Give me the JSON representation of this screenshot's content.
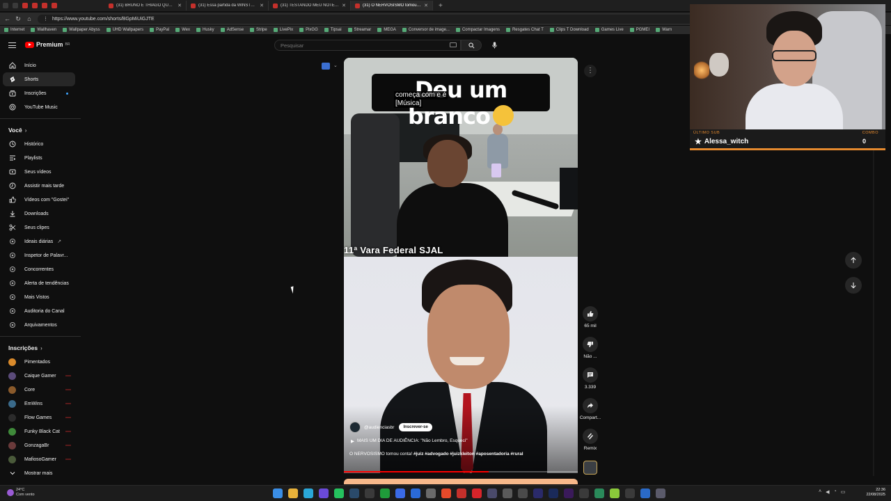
{
  "browser": {
    "tabs": [
      {
        "title": "(31) BRUNO E THIAGO QUATRO CA",
        "active": false
      },
      {
        "title": "(31) Essa partida da WINSTREAK",
        "active": false
      },
      {
        "title": "(31) TESTANDO MEU NOTEBOOK",
        "active": false
      },
      {
        "title": "(31) O NERVOSISMO tomou conta",
        "active": true
      }
    ],
    "new_tab": "+",
    "url": "https://www.youtube.com/shorts/BGpMiUiGJTE",
    "bookmarks": [
      "Internet",
      "Wallhaven",
      "Wallpaper Abyss",
      "UHD Wallpapers",
      "PayPal",
      "Wex",
      "Husky",
      "AdSense",
      "Stripe",
      "LivePix",
      "PixGG",
      "Tipsai",
      "Streamar",
      "MEGA",
      "Conversor de image...",
      "Compactar Imagens",
      "Resgates Chat T",
      "Clips T Download",
      "Games Live",
      "PGMEI",
      "Warn"
    ]
  },
  "youtube": {
    "logo_text": "Premium",
    "logo_region": "BR",
    "search_placeholder": "Pesquisar"
  },
  "sidebar": {
    "main": [
      {
        "label": "Início",
        "icon": "home-icon"
      },
      {
        "label": "Shorts",
        "icon": "shorts-icon",
        "active": true
      },
      {
        "label": "Inscrições",
        "icon": "subscriptions-icon"
      },
      {
        "label": "YouTube Music",
        "icon": "music-icon"
      }
    ],
    "you_heading": "Você",
    "you": [
      {
        "label": "Histórico",
        "icon": "history-icon"
      },
      {
        "label": "Playlists",
        "icon": "playlists-icon"
      },
      {
        "label": "Seus vídeos",
        "icon": "your-videos-icon"
      },
      {
        "label": "Assistir mais tarde",
        "icon": "watch-later-icon"
      },
      {
        "label": "Vídeos com \"Gostei\"",
        "icon": "like-icon"
      },
      {
        "label": "Downloads",
        "icon": "download-icon"
      },
      {
        "label": "Seus clipes",
        "icon": "clips-icon"
      },
      {
        "label": "Ideais diárias",
        "icon": "extension-icon"
      },
      {
        "label": "Inspetor de Palavr...",
        "icon": "extension-icon"
      },
      {
        "label": "Concorrentes",
        "icon": "extension-icon"
      },
      {
        "label": "Alerta de tendências",
        "icon": "extension-icon"
      },
      {
        "label": "Mais Vistos",
        "icon": "extension-icon"
      },
      {
        "label": "Auditoria do Canal",
        "icon": "extension-icon"
      },
      {
        "label": "Arquivamentos",
        "icon": "extension-icon"
      }
    ],
    "subs_heading": "Inscrições",
    "subs": [
      {
        "label": "Pimentados",
        "color": "#d98a2b"
      },
      {
        "label": "Caique Gamer",
        "color": "#5b4b7a"
      },
      {
        "label": "Core",
        "color": "#8a5a2b"
      },
      {
        "label": "EmWins",
        "color": "#3a6a8a"
      },
      {
        "label": "Flow Games",
        "color": "#2b2b2b"
      },
      {
        "label": "Funky Black Cat",
        "color": "#3f8a3a"
      },
      {
        "label": "GonzagaBr",
        "color": "#6a3a3a"
      },
      {
        "label": "MafiosoGamer",
        "color": "#4a5a3a"
      }
    ],
    "show_more": "Mostrar mais"
  },
  "short": {
    "caption_big": "Deu um branco",
    "closed_caption_line1": "começa com e é",
    "closed_caption_line2": "[Música]",
    "court_label": "11ª Vara Federal SJAL",
    "channel": "@audienciasbr",
    "subscribe": "Inscrever-se",
    "playlist": "MAIS UM DIA DE AUDIÊNCIA: \"Não Lembro, Esqueci\"",
    "description": "O NERVOSISMO tomou conta!",
    "hashtags": "#juiz #advogado #juizkleiton #aposentadoria #rural",
    "progress": 0.62
  },
  "actions": {
    "likes": "65 mil",
    "dislike": "Não ...",
    "comments": "3.339",
    "share": "Compart...",
    "remix": "Remix"
  },
  "webcam": {
    "latest_sub_label": "ÚLTIMO SUB",
    "subscriber_name": "Alessa_witch",
    "combo_label": "COMBO",
    "combo_count": "0"
  },
  "taskbar": {
    "weather_temp": "24°C",
    "weather_desc": "Com vento",
    "time": "22:36",
    "date": "22/08/2025"
  }
}
